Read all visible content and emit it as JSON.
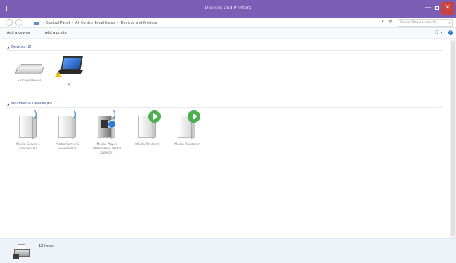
{
  "window": {
    "title": "Devices and Printers",
    "min_glyph": "—",
    "close_glyph": "✕"
  },
  "address": {
    "back_glyph": "←",
    "forward_glyph": "→",
    "up_glyph": "↑",
    "breadcrumbs": [
      "Control Panel",
      "All Control Panel Items",
      "Devices and Printers"
    ],
    "search_placeholder": "Search Devices and Pr...",
    "dropdown_glyph": "▾",
    "refresh_glyph": "↻"
  },
  "commands": {
    "add_device": "Add a device",
    "add_printer": "Add a printer",
    "help_glyph": "?"
  },
  "groups": {
    "devices": {
      "title": "Devices (2)",
      "items": [
        {
          "label": "Storage Device",
          "icon": "external-drive-icon"
        },
        {
          "label": "PC",
          "icon": "laptop-warning-icon"
        }
      ]
    },
    "multimedia": {
      "title": "Multimedia Devices (6)",
      "items": [
        {
          "label": "Media Server 1 (Server-01)",
          "icon": "media-server-icon"
        },
        {
          "label": "Media Server 2 (Server-02)",
          "icon": "media-server-icon"
        },
        {
          "label": "Media Player (Networked Media Device)",
          "icon": "media-player-icon"
        },
        {
          "label": "Media Renderer",
          "icon": "media-renderer-play-icon"
        },
        {
          "label": "Media Renderer",
          "icon": "media-renderer-play-icon"
        }
      ]
    }
  },
  "status": {
    "count": "13 items"
  },
  "colors": {
    "titlebar": "#7b5fb6",
    "close": "#c84343",
    "group_header": "#2d4f86",
    "play": "#4caf50"
  }
}
